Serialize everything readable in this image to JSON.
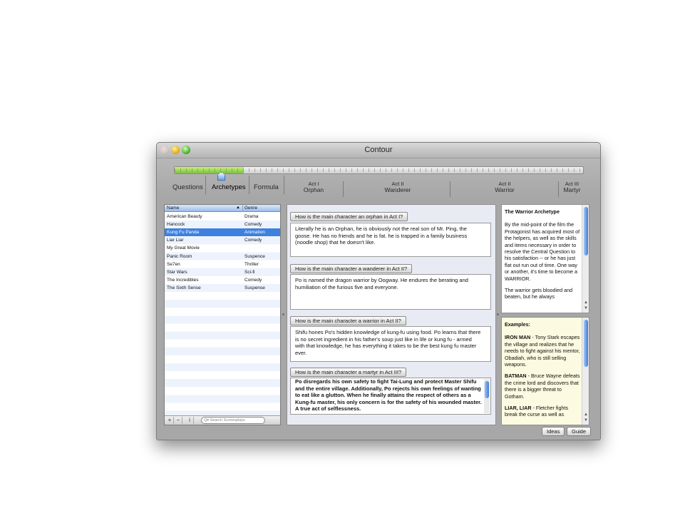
{
  "window": {
    "title": "Contour"
  },
  "timeline": {
    "tabs": [
      "Questions",
      "Archetypes",
      "Formula"
    ],
    "active_tab": "Archetypes",
    "progress_fraction": 0.17,
    "acts": [
      {
        "act": "Act I",
        "name": "Orphan"
      },
      {
        "act": "Act II",
        "name": "Wanderer"
      },
      {
        "act": "Act II",
        "name": "Warrior"
      },
      {
        "act": "Act III",
        "name": "Martyr"
      }
    ]
  },
  "list": {
    "columns": [
      "Name",
      "Genre"
    ],
    "sort_indicator": "▲",
    "rows": [
      {
        "name": "American Beauty",
        "genre": "Drama"
      },
      {
        "name": "Hancock",
        "genre": "Comedy"
      },
      {
        "name": "Kung Fu Panda",
        "genre": "Animation"
      },
      {
        "name": "Liar Liar",
        "genre": "Comedy"
      },
      {
        "name": "My Great Movie",
        "genre": ""
      },
      {
        "name": "Panic Room",
        "genre": "Suspence"
      },
      {
        "name": "Se7en",
        "genre": "Thriller"
      },
      {
        "name": "Star Wars",
        "genre": "Sci-fi"
      },
      {
        "name": "The Incredibles",
        "genre": "Comedy"
      },
      {
        "name": "The Sixth Sense",
        "genre": "Suspense"
      }
    ],
    "selected_row": "Kung Fu Panda",
    "footer": {
      "add": "+",
      "remove": "−",
      "info": "i",
      "search_placeholder": "Q▾ Search Screenplays"
    }
  },
  "questions": [
    {
      "q": "How is the main character an orphan in Act I?",
      "a": "Literally he is an Orphan, he is obviously not the real son of Mr. Ping, the goose. He has no friends and he is fat. he is trapped in a family business (noodle shop) that he doesn't like."
    },
    {
      "q": "How is the main character a wanderer in Act II?",
      "a": "Po is named the dragon warrior by Oogway. He endures the berating and humiliation of the furious five and everyone."
    },
    {
      "q": "How is the main character a warrior in Act II?",
      "a": "Shifu hones Po's hidden knowledge of kung-fu using food. Po learns that there is no secret ingredient in his father's soup just like in life or kung fu - armed with that knowledge, he has everything it takes to be the best kung fu master ever."
    },
    {
      "q": "How is the main character a martyr in Act III?",
      "a": "Po disregards his own safety to fight Tai-Lung and protect Master Shifu and the entire village. Additionally, Po rejects his own feelings of wanting to eat like a glutton. When he finally attains the respect of others as a Kung-fu master, his only concern is for the safety of his wounded master. A true act of selflessness."
    }
  ],
  "archetype": {
    "heading": "The Warrior Archetype",
    "p1": "By the mid-point of the film the Protagonist has acquired most of the helpers, as well as the skills and items necessary in order to resolve the Central Question to his satisfaction -- or he has just flat out run out of time. One way or another, it's time to become a WARRIOR.",
    "p2": "The warrior gets bloodied and beaten, but he always"
  },
  "examples": {
    "heading": "Examples:",
    "e1_title": "IRON MAN",
    "e1_text": " - Tony Stark escapes the village and realizes that he needs to fight against his mentor, Obadiah, who is still selling weapons.",
    "e2_title": "BATMAN",
    "e2_text": " - Bruce Wayne defeats the crime lord and discovers that there is a bigger threat to Gotham.",
    "e3_title": "LIAR, LIAR",
    "e3_text": " - Fletcher fights break the curse as well as"
  },
  "buttons": {
    "ideas": "Ideas",
    "guide": "Guide"
  },
  "colors": {
    "selection": "#3d80df",
    "progress": "#7ac13b",
    "examples_bg": "#fcfae0"
  }
}
